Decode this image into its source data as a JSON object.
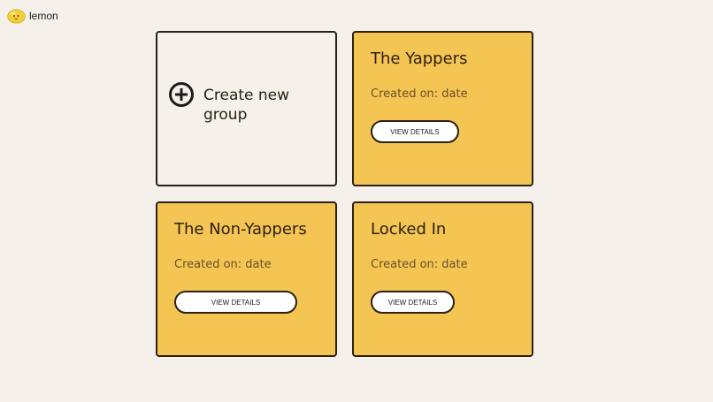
{
  "brand": {
    "name": "lemon",
    "logo_icon": "lemon-face-icon",
    "logo_color": "#f2cf3b"
  },
  "create_card": {
    "icon": "plus-circle-icon",
    "label": "Create new group"
  },
  "groups": [
    {
      "title": "The Yappers",
      "created": "Created on: date",
      "button_label": "VIEW DETAILS"
    },
    {
      "title": "The Non-Yappers",
      "created": "Created on: date",
      "button_label": "VIEW DETAILS"
    },
    {
      "title": "Locked In",
      "created": "Created on: date",
      "button_label": "VIEW DETAILS"
    }
  ],
  "colors": {
    "background": "#f5f0e9",
    "card": "#f5c554",
    "border": "#2b2114",
    "date_text": "#6b5026"
  }
}
